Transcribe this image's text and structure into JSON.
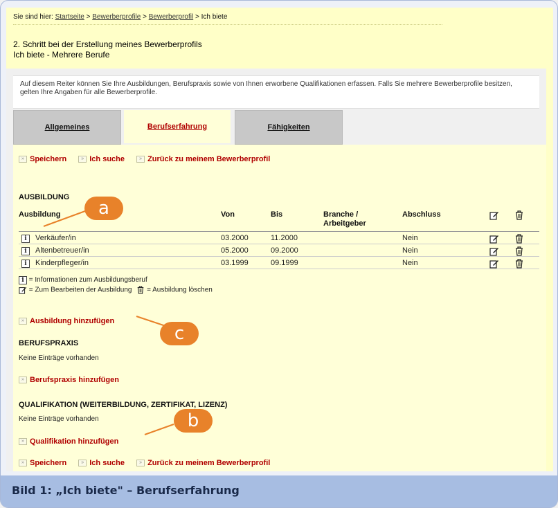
{
  "breadcrumb": {
    "prefix": "Sie sind hier:",
    "items": [
      "Startseite",
      "Bewerberprofile",
      "Bewerberprofil"
    ],
    "separator": ">",
    "current": "Ich biete"
  },
  "header": {
    "step_line": "2. Schritt bei der Erstellung meines Bewerberprofils",
    "subtitle": "Ich biete - Mehrere Berufe"
  },
  "info_text": "Auf diesem Reiter können Sie Ihre Ausbildungen, Berufspraxis sowie von Ihnen erworbene Qualifikationen erfassen. Falls Sie mehrere Bewerberprofile besitzen, gelten Ihre Angaben für alle Bewerberprofile.",
  "tabs": [
    {
      "label": "Allgemeines",
      "active": false
    },
    {
      "label": "Berufserfahrung",
      "active": true
    },
    {
      "label": "Fähigkeiten",
      "active": false
    }
  ],
  "actions": {
    "save": "Speichern",
    "search": "Ich suche",
    "back": "Zurück zu meinem Bewerberprofil"
  },
  "ausbildung": {
    "heading": "AUSBILDUNG",
    "columns": {
      "name": "Ausbildung",
      "from": "Von",
      "to": "Bis",
      "branch": "Branche / Arbeitgeber",
      "degree": "Abschluss"
    },
    "rows": [
      {
        "name": "Verkäufer/in",
        "from": "03.2000",
        "to": "11.2000",
        "branch": "",
        "degree": "Nein"
      },
      {
        "name": "Altenbetreuer/in",
        "from": "05.2000",
        "to": "09.2000",
        "branch": "",
        "degree": "Nein"
      },
      {
        "name": "Kinderpfleger/in",
        "from": "03.1999",
        "to": "09.1999",
        "branch": "",
        "degree": "Nein"
      }
    ],
    "legend_info": "= Informationen zum Ausbildungsberuf",
    "legend_edit": "= Zum Bearbeiten der Ausbildung",
    "legend_delete": "= Ausbildung löschen",
    "add_link": "Ausbildung hinzufügen"
  },
  "berufspraxis": {
    "heading": "BERUFSPRAXIS",
    "empty": "Keine Einträge vorhanden",
    "add_link": "Berufspraxis hinzufügen"
  },
  "qualifikation": {
    "heading": "QUALIFIKATION (WEITERBILDUNG, ZERTIFIKAT, LIZENZ)",
    "empty": "Keine Einträge vorhanden",
    "add_link": "Qualifikation hinzufügen"
  },
  "callouts": {
    "a": "a",
    "b": "b",
    "c": "c"
  },
  "caption": "Bild 1: „Ich biete\" – Berufserfahrung",
  "colors": {
    "accent_red": "#b00000",
    "yellow": "#ffffd8",
    "callout": "#e8822a",
    "caption_bar": "#a7bde2"
  }
}
